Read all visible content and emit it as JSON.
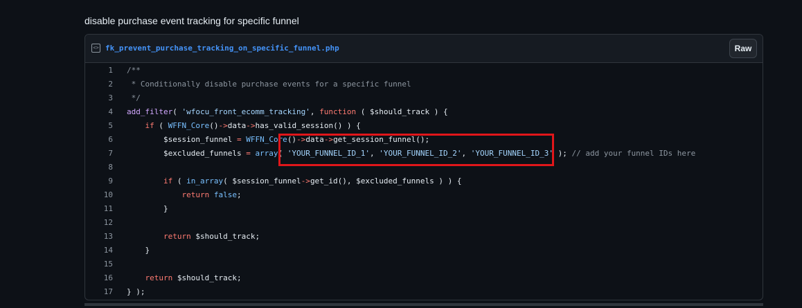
{
  "gist": {
    "description": "disable purchase event tracking for specific funnel",
    "file_name": "fk_prevent_purchase_tracking_on_specific_funnel.php",
    "raw_label": "Raw",
    "icon": "code-file-icon"
  },
  "code": {
    "lines": [
      {
        "n": "1",
        "html": "<span class=\"c\">/**</span>"
      },
      {
        "n": "2",
        "html": "<span class=\"c\"> * Conditionally disable purchase events for a specific funnel</span>"
      },
      {
        "n": "3",
        "html": "<span class=\"c\"> */</span>"
      },
      {
        "n": "4",
        "html": "<span class=\"f\">add_filter</span>( <span class=\"s\">'wfocu_front_ecomm_tracking'</span>, <span class=\"k\">function</span> ( <span class=\"v\">$should_track</span> ) {"
      },
      {
        "n": "5",
        "html": "    <span class=\"k\">if</span> ( <span class=\"cl\">WFFN_Core</span>()<span class=\"op\">-></span>data<span class=\"op\">-></span>has_valid_session() ) {"
      },
      {
        "n": "6",
        "html": "        $session_funnel <span class=\"op\">=</span> <span class=\"cl\">WFFN_Core</span>()<span class=\"op\">-></span>data<span class=\"op\">-></span>get_session_funnel();"
      },
      {
        "n": "7",
        "html": "        $excluded_funnels <span class=\"op\">=</span> <span class=\"cl\">array</span>( <span class=\"s\">'YOUR_FUNNEL_ID_1'</span>, <span class=\"s\">'YOUR_FUNNEL_ID_2'</span>, <span class=\"s\">'YOUR_FUNNEL_ID_3'</span> ); <span class=\"c\">// add your funnel IDs here</span>"
      },
      {
        "n": "8",
        "html": ""
      },
      {
        "n": "9",
        "html": "        <span class=\"k\">if</span> ( <span class=\"cl\">in_array</span>( $session_funnel<span class=\"op\">-></span>get_id(), $excluded_funnels ) ) {"
      },
      {
        "n": "10",
        "html": "            <span class=\"k\">return</span> <span class=\"cl\">false</span>;"
      },
      {
        "n": "11",
        "html": "        }"
      },
      {
        "n": "12",
        "html": ""
      },
      {
        "n": "13",
        "html": "        <span class=\"k\">return</span> $should_track;"
      },
      {
        "n": "14",
        "html": "    }"
      },
      {
        "n": "15",
        "html": ""
      },
      {
        "n": "16",
        "html": "    <span class=\"k\">return</span> $should_track;"
      },
      {
        "n": "17",
        "html": "} );"
      }
    ]
  },
  "annotation": {
    "color": "#e0161a",
    "target": "excluded funnel IDs"
  },
  "colors": {
    "background": "#0d1117",
    "header": "#161b22",
    "border": "#30363d",
    "link": "#4493f8",
    "keyword": "#ff7b72",
    "string": "#a5d6ff",
    "function": "#d2a8ff",
    "constant": "#79c0ff",
    "comment": "#8d96a0"
  }
}
